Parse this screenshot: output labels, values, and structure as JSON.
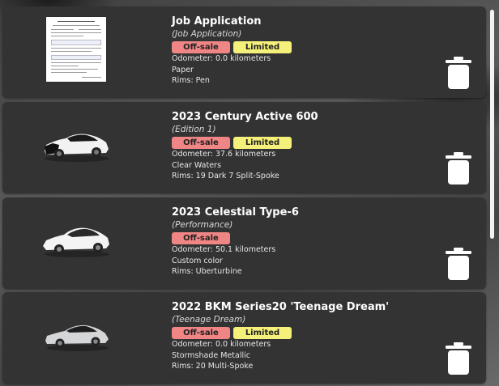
{
  "items": [
    {
      "title": "Job Application",
      "subtitle": "(Job Application)",
      "badges": {
        "offsale": "Off-sale",
        "limited": "Limited"
      },
      "odometer": "Odometer: 0.0 kilometers",
      "color": "Paper",
      "rims": "Rims: Pen",
      "thumbnail_icon": "document-icon"
    },
    {
      "title": "2023 Century Active 600",
      "subtitle": "(Edition 1)",
      "badges": {
        "offsale": "Off-sale",
        "limited": "Limited"
      },
      "odometer": "Odometer: 37.6 kilometers",
      "color": "Clear Waters",
      "rims": "Rims: 19 Dark 7 Split-Spoke",
      "thumbnail_icon": "car-icon",
      "car_body": "#f2f2f2",
      "car_roof": "#1a1a1a"
    },
    {
      "title": "2023 Celestial Type-6",
      "subtitle": "(Performance)",
      "badges": {
        "offsale": "Off-sale"
      },
      "odometer": "Odometer: 50.1 kilometers",
      "color": "Custom color",
      "rims": "Rims: Uberturbine",
      "thumbnail_icon": "car-icon",
      "car_body": "#f4f4f4",
      "car_roof": "#2a2a2a"
    },
    {
      "title": "2022 BKM Series20 'Teenage Dream'",
      "subtitle": "(Teenage Dream)",
      "badges": {
        "offsale": "Off-sale",
        "limited": "Limited"
      },
      "odometer": "Odometer: 0.0 kilometers",
      "color": "Stormshade Metallic",
      "rims": "Rims: 20 Multi-Spoke",
      "thumbnail_icon": "car-icon",
      "car_body": "#d4d6d8",
      "car_roof": "#1e1e1e"
    }
  ],
  "accent": {
    "offsale": "#f08585",
    "limited": "#f4f07a",
    "card": "#333333"
  }
}
